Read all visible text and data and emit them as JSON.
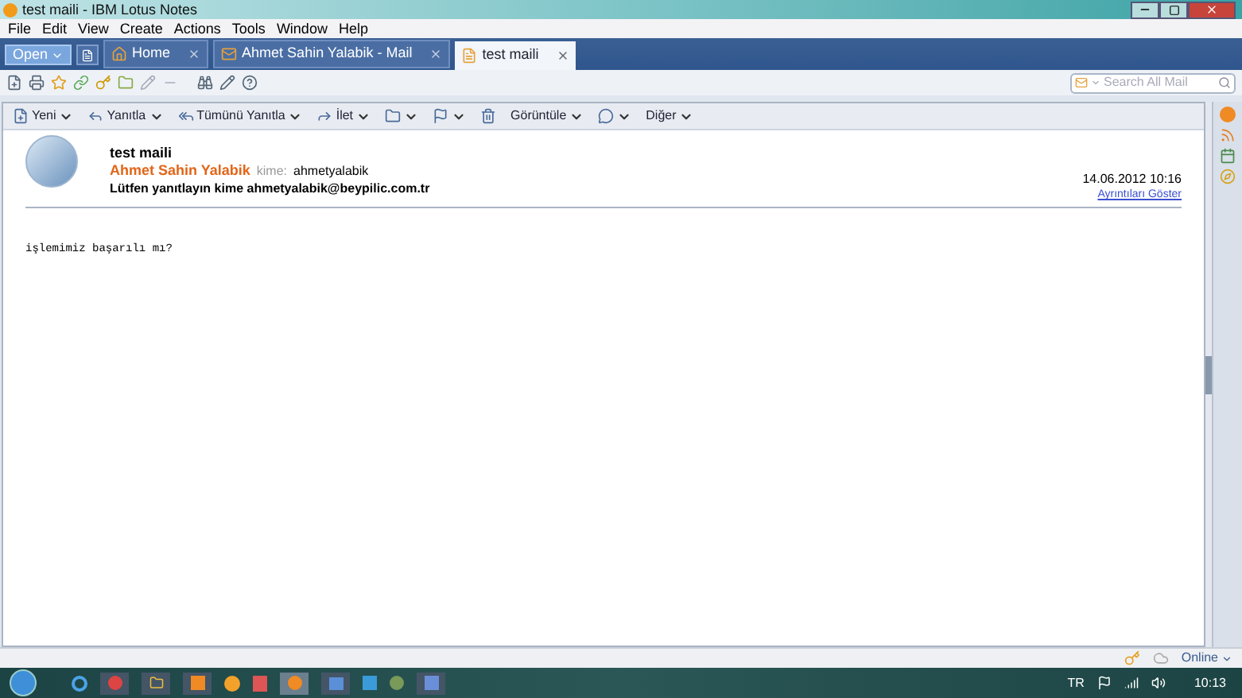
{
  "window": {
    "title": "test maili - IBM Lotus Notes"
  },
  "menu": [
    "File",
    "Edit",
    "View",
    "Create",
    "Actions",
    "Tools",
    "Window",
    "Help"
  ],
  "open_button": "Open",
  "tabs": [
    {
      "label": "Home",
      "kind": "home",
      "selected": false
    },
    {
      "label": "Ahmet Sahin Yalabik - Mail",
      "kind": "mail",
      "selected": false
    },
    {
      "label": "test maili",
      "kind": "doc",
      "selected": true
    }
  ],
  "search": {
    "placeholder": "Search All Mail"
  },
  "actions": [
    {
      "kind": "new",
      "label": "Yeni",
      "dropdown": true
    },
    {
      "kind": "reply",
      "label": "Yanıtla",
      "dropdown": true
    },
    {
      "kind": "replyall",
      "label": "Tümünü Yanıtla",
      "dropdown": true
    },
    {
      "kind": "forward",
      "label": "İlet",
      "dropdown": true
    },
    {
      "kind": "folder",
      "dropdown": true
    },
    {
      "kind": "flag",
      "dropdown": true
    },
    {
      "kind": "trash",
      "dropdown": false
    },
    {
      "kind": "view",
      "label": "Görüntüle",
      "dropdown": true
    },
    {
      "kind": "chat",
      "dropdown": true
    },
    {
      "kind": "more",
      "label": "Diğer",
      "dropdown": true
    }
  ],
  "message": {
    "subject": "test maili",
    "sender": "Ahmet Sahin Yalabik",
    "to_label": "kime:",
    "to": "ahmetyalabik",
    "reply_to": "Lütfen yanıtlayın kime ahmetyalabik@beypilic.com.tr",
    "date": "14.06.2012 10:16",
    "details_link": "Ayrıntıları Göster",
    "body": "işlemimiz başarılı mı?"
  },
  "status_bar": {
    "status": "Online"
  },
  "taskbar": {
    "language": "TR",
    "time": "10:13"
  }
}
